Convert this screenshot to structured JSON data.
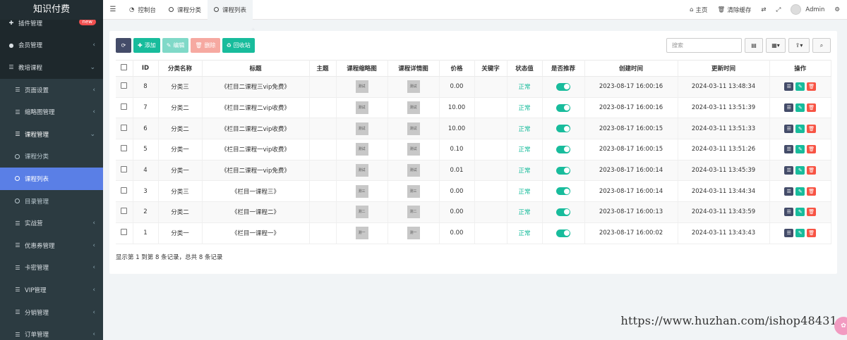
{
  "app": {
    "logo": "知识付费"
  },
  "sidebar": {
    "items": [
      {
        "label": "插件管理",
        "icon": "plug-icon",
        "badge": "new"
      },
      {
        "label": "会员管理",
        "icon": "user-icon"
      },
      {
        "label": "教培课程",
        "icon": "list-icon"
      },
      {
        "label": "页面设置",
        "icon": "list-icon"
      },
      {
        "label": "缩略图管理",
        "icon": "list-icon"
      },
      {
        "label": "课程管理",
        "icon": "list-icon"
      },
      {
        "label": "课程分类",
        "icon": "circle-icon"
      },
      {
        "label": "课程列表",
        "icon": "circle-icon"
      },
      {
        "label": "目录管理",
        "icon": "circle-icon"
      },
      {
        "label": "实战营",
        "icon": "list-icon"
      },
      {
        "label": "优惠券管理",
        "icon": "list-icon"
      },
      {
        "label": "卡密管理",
        "icon": "list-icon"
      },
      {
        "label": "VIP管理",
        "icon": "list-icon"
      },
      {
        "label": "分销管理",
        "icon": "list-icon"
      },
      {
        "label": "订单管理",
        "icon": "list-icon"
      }
    ]
  },
  "topbar": {
    "tabs": [
      {
        "label": "控制台"
      },
      {
        "label": "课程分类"
      },
      {
        "label": "课程列表"
      }
    ],
    "home": "主页",
    "clear_cache": "清除缓存",
    "user": "Admin"
  },
  "toolbar": {
    "add": "添加",
    "edit": "编辑",
    "delete": "删除",
    "recycle": "回收站",
    "search_placeholder": "搜索"
  },
  "table": {
    "headers": [
      "ID",
      "分类名称",
      "标题",
      "主题",
      "课程缩略图",
      "课程详情图",
      "价格",
      "关键字",
      "状态值",
      "是否推荐",
      "创建时间",
      "更新时间",
      "操作"
    ],
    "rows": [
      {
        "id": "8",
        "category": "分类三",
        "title": "《栏目二课程三vip免费》",
        "thumb": "测试",
        "detail": "测试",
        "price": "0.00",
        "status": "正常",
        "recommend": true,
        "created": "2023-08-17 16:00:16",
        "updated": "2024-03-11 13:48:34"
      },
      {
        "id": "7",
        "category": "分类二",
        "title": "《栏目二课程二vip收费》",
        "thumb": "测试",
        "detail": "测试",
        "price": "10.00",
        "status": "正常",
        "recommend": true,
        "created": "2023-08-17 16:00:16",
        "updated": "2024-03-11 13:51:39"
      },
      {
        "id": "6",
        "category": "分类二",
        "title": "《栏目二课程二vip收费》",
        "thumb": "测试",
        "detail": "测试",
        "price": "10.00",
        "status": "正常",
        "recommend": true,
        "created": "2023-08-17 16:00:15",
        "updated": "2024-03-11 13:51:33"
      },
      {
        "id": "5",
        "category": "分类一",
        "title": "《栏目二课程一vip收费》",
        "thumb": "测试",
        "detail": "测试",
        "price": "0.10",
        "status": "正常",
        "recommend": true,
        "created": "2023-08-17 16:00:15",
        "updated": "2024-03-11 13:51:26"
      },
      {
        "id": "4",
        "category": "分类一",
        "title": "《栏目二课程一vip免费》",
        "thumb": "测试",
        "detail": "测试",
        "price": "0.01",
        "status": "正常",
        "recommend": true,
        "created": "2023-08-17 16:00:14",
        "updated": "2024-03-11 13:45:39"
      },
      {
        "id": "3",
        "category": "分类三",
        "title": "《栏目一课程三》",
        "thumb": "测三",
        "detail": "测三",
        "price": "0.00",
        "status": "正常",
        "recommend": true,
        "created": "2023-08-17 16:00:14",
        "updated": "2024-03-11 13:44:34"
      },
      {
        "id": "2",
        "category": "分类二",
        "title": "《栏目一课程二》",
        "thumb": "测二",
        "detail": "测二",
        "price": "0.00",
        "status": "正常",
        "recommend": true,
        "created": "2023-08-17 16:00:13",
        "updated": "2024-03-11 13:43:59"
      },
      {
        "id": "1",
        "category": "分类一",
        "title": "《栏目一课程一》",
        "thumb": "测一",
        "detail": "测一",
        "price": "0.00",
        "status": "正常",
        "recommend": true,
        "created": "2023-08-17 16:00:02",
        "updated": "2024-03-11 13:43:43"
      }
    ],
    "footer": "显示第 1 到第 8 条记录，总共 8 条记录"
  },
  "watermark": "https://www.huzhan.com/ishop48431",
  "colors": {
    "sidebar": "#222d32",
    "active": "#5a7fe6",
    "green": "#18bc9c",
    "red": "#f75444",
    "dark": "#444c69"
  }
}
